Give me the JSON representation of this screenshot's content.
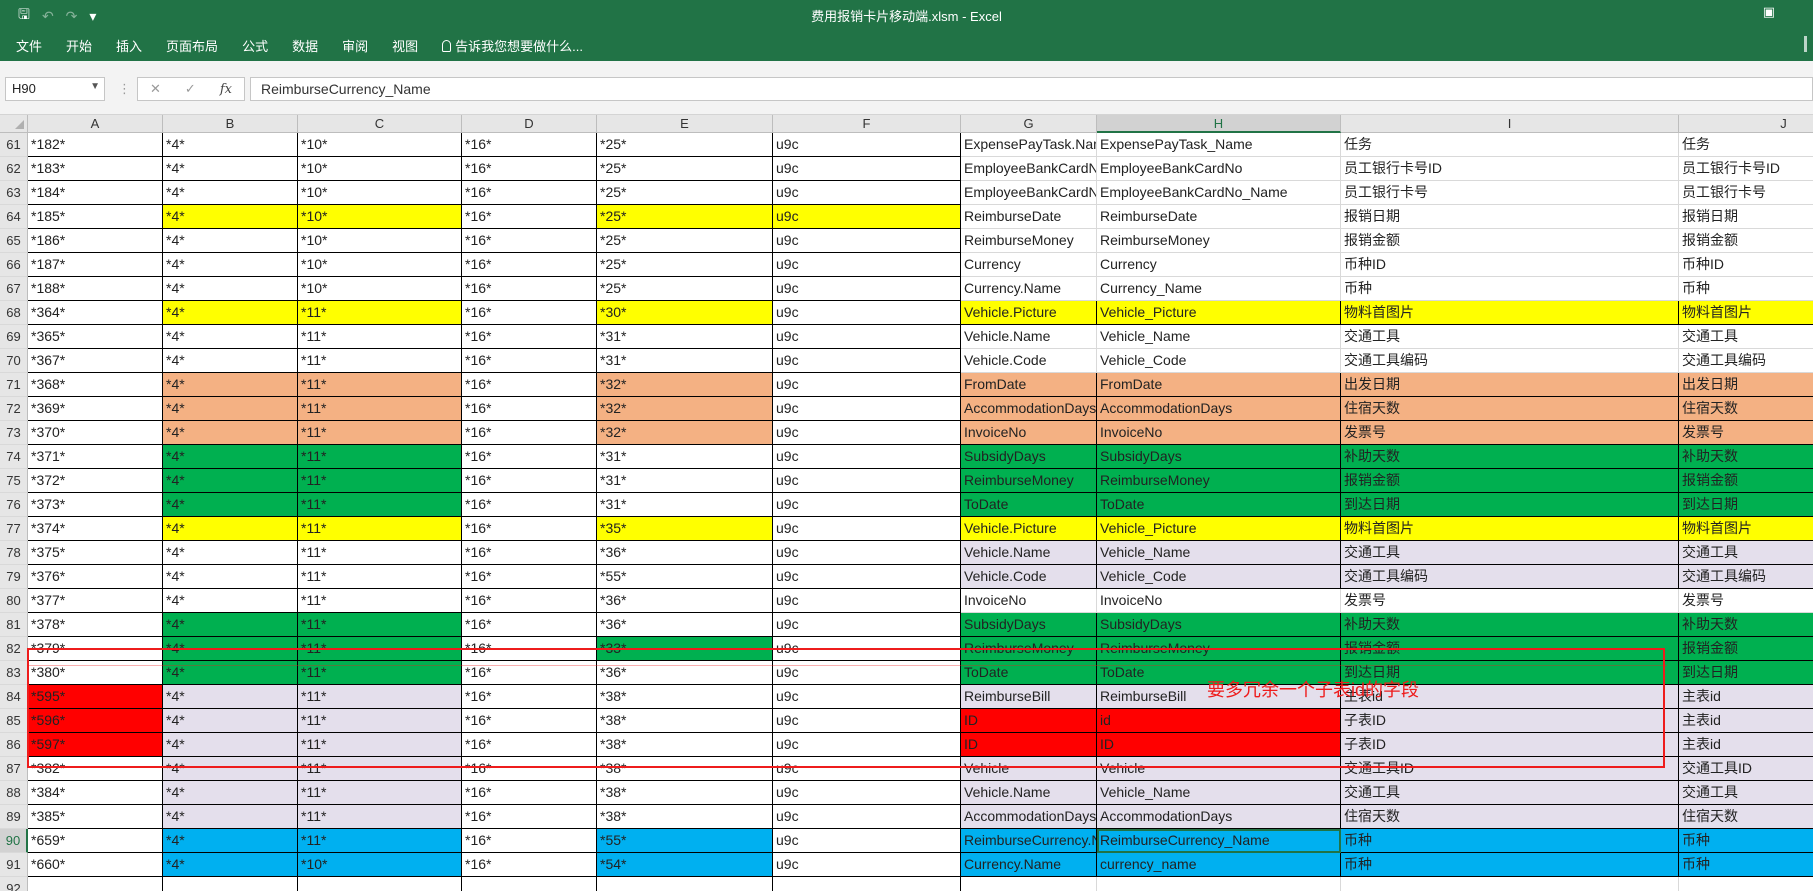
{
  "window": {
    "title": "费用报销卡片移动端.xlsm - Excel"
  },
  "quick_access": {
    "save_icon": "save-icon",
    "undo_icon": "undo-icon",
    "redo_icon": "redo-icon",
    "customize_icon": "customize-icon"
  },
  "ribbon": {
    "tabs": [
      "文件",
      "开始",
      "插入",
      "页面布局",
      "公式",
      "数据",
      "审阅",
      "视图"
    ],
    "tell_me": "告诉我您想要做什么..."
  },
  "formula_bar": {
    "name_box": "H90",
    "cancel": "✕",
    "enter": "✓",
    "fx": "fx",
    "value": "ReimburseCurrency_Name"
  },
  "columns": [
    "A",
    "B",
    "C",
    "D",
    "E",
    "F",
    "G",
    "H",
    "I",
    "J"
  ],
  "selected_column": "H",
  "selected_row": "90",
  "rows": [
    {
      "n": "61",
      "fill": {
        "A": "white",
        "B": "white",
        "C": "white",
        "D": "white",
        "E": "white",
        "F": "white",
        "G": "w",
        "H": "w",
        "I": "w",
        "J": "w"
      },
      "v": [
        "*182*",
        "*4*",
        "*10*",
        "*16*",
        "*25*",
        "u9c",
        "ExpensePayTask.Name",
        "ExpensePayTask_Name",
        "任务",
        "任务"
      ]
    },
    {
      "n": "62",
      "fill": {},
      "v": [
        "*183*",
        "*4*",
        "*10*",
        "*16*",
        "*25*",
        "u9c",
        "EmployeeBankCardNo",
        "EmployeeBankCardNo",
        "员工银行卡号ID",
        "员工银行卡号ID"
      ]
    },
    {
      "n": "63",
      "fill": {},
      "v": [
        "*184*",
        "*4*",
        "*10*",
        "*16*",
        "*25*",
        "u9c",
        "EmployeeBankCardNo",
        "EmployeeBankCardNo_Name",
        "员工银行卡号",
        "员工银行卡号"
      ]
    },
    {
      "n": "64",
      "fill": {
        "B": "yellow",
        "C": "yellow",
        "E": "yellow",
        "F": "yellow"
      },
      "v": [
        "*185*",
        "*4*",
        "*10*",
        "*16*",
        "*25*",
        "u9c",
        "ReimburseDate",
        "ReimburseDate",
        "报销日期",
        "报销日期"
      ]
    },
    {
      "n": "65",
      "fill": {},
      "v": [
        "*186*",
        "*4*",
        "*10*",
        "*16*",
        "*25*",
        "u9c",
        "ReimburseMoney",
        "ReimburseMoney",
        "报销金额",
        "报销金额"
      ]
    },
    {
      "n": "66",
      "fill": {},
      "v": [
        "*187*",
        "*4*",
        "*10*",
        "*16*",
        "*25*",
        "u9c",
        "Currency",
        "Currency",
        "币种ID",
        "币种ID"
      ]
    },
    {
      "n": "67",
      "fill": {},
      "v": [
        "*188*",
        "*4*",
        "*10*",
        "*16*",
        "*25*",
        "u9c",
        "Currency.Name",
        "Currency_Name",
        "币种",
        "币种"
      ]
    },
    {
      "n": "68",
      "fill": {
        "B": "yellow",
        "C": "yellow",
        "E": "yellow",
        "G": "yellow",
        "H": "yellow",
        "I": "yellow",
        "J": "yellow"
      },
      "v": [
        "*364*",
        "*4*",
        "*11*",
        "*16*",
        "*30*",
        "u9c",
        "Vehicle.Picture",
        "Vehicle_Picture",
        "物料首图片",
        "物料首图片"
      ]
    },
    {
      "n": "69",
      "fill": {},
      "v": [
        "*365*",
        "*4*",
        "*11*",
        "*16*",
        "*31*",
        "u9c",
        "Vehicle.Name",
        "Vehicle_Name",
        "交通工具",
        "交通工具"
      ]
    },
    {
      "n": "70",
      "fill": {},
      "v": [
        "*367*",
        "*4*",
        "*11*",
        "*16*",
        "*31*",
        "u9c",
        "Vehicle.Code",
        "Vehicle_Code",
        "交通工具编码",
        "交通工具编码"
      ]
    },
    {
      "n": "71",
      "fill": {
        "B": "peach",
        "C": "peach",
        "E": "peach",
        "G": "peach",
        "H": "peach",
        "I": "peach",
        "J": "peach"
      },
      "v": [
        "*368*",
        "*4*",
        "*11*",
        "*16*",
        "*32*",
        "u9c",
        "FromDate",
        "FromDate",
        "出发日期",
        "出发日期"
      ]
    },
    {
      "n": "72",
      "fill": {
        "B": "peach",
        "C": "peach",
        "E": "peach",
        "G": "peach",
        "H": "peach",
        "I": "peach",
        "J": "peach"
      },
      "v": [
        "*369*",
        "*4*",
        "*11*",
        "*16*",
        "*32*",
        "u9c",
        "AccommodationDays",
        "AccommodationDays",
        "住宿天数",
        "住宿天数"
      ]
    },
    {
      "n": "73",
      "fill": {
        "B": "peach",
        "C": "peach",
        "E": "peach",
        "G": "peach",
        "H": "peach",
        "I": "peach",
        "J": "peach"
      },
      "v": [
        "*370*",
        "*4*",
        "*11*",
        "*16*",
        "*32*",
        "u9c",
        "InvoiceNo",
        "InvoiceNo",
        "发票号",
        "发票号"
      ]
    },
    {
      "n": "74",
      "fill": {
        "B": "green",
        "C": "green",
        "G": "green",
        "H": "green",
        "I": "green",
        "J": "green"
      },
      "v": [
        "*371*",
        "*4*",
        "*11*",
        "*16*",
        "*31*",
        "u9c",
        "SubsidyDays",
        "SubsidyDays",
        "补助天数",
        "补助天数"
      ]
    },
    {
      "n": "75",
      "fill": {
        "B": "green",
        "C": "green",
        "G": "green",
        "H": "green",
        "I": "green",
        "J": "green"
      },
      "v": [
        "*372*",
        "*4*",
        "*11*",
        "*16*",
        "*31*",
        "u9c",
        "ReimburseMoney",
        "ReimburseMoney",
        "报销金额",
        "报销金额"
      ]
    },
    {
      "n": "76",
      "fill": {
        "B": "green",
        "C": "green",
        "G": "green",
        "H": "green",
        "I": "green",
        "J": "green"
      },
      "v": [
        "*373*",
        "*4*",
        "*11*",
        "*16*",
        "*31*",
        "u9c",
        "ToDate",
        "ToDate",
        "到达日期",
        "到达日期"
      ]
    },
    {
      "n": "77",
      "fill": {
        "B": "yellow",
        "C": "yellow",
        "E": "yellow",
        "G": "yellow",
        "H": "yellow",
        "I": "yellow",
        "J": "yellow"
      },
      "v": [
        "*374*",
        "*4*",
        "*11*",
        "*16*",
        "*35*",
        "u9c",
        "Vehicle.Picture",
        "Vehicle_Picture",
        "物料首图片",
        "物料首图片"
      ]
    },
    {
      "n": "78",
      "fill": {
        "G": "lav",
        "H": "lav",
        "I": "lav",
        "J": "lav"
      },
      "v": [
        "*375*",
        "*4*",
        "*11*",
        "*16*",
        "*36*",
        "u9c",
        "Vehicle.Name",
        "Vehicle_Name",
        "交通工具",
        "交通工具"
      ]
    },
    {
      "n": "79",
      "fill": {
        "G": "lav",
        "H": "lav",
        "I": "lav",
        "J": "lav"
      },
      "v": [
        "*376*",
        "*4*",
        "*11*",
        "*16*",
        "*55*",
        "u9c",
        "Vehicle.Code",
        "Vehicle_Code",
        "交通工具编码",
        "交通工具编码"
      ]
    },
    {
      "n": "80",
      "fill": {},
      "v": [
        "*377*",
        "*4*",
        "*11*",
        "*16*",
        "*36*",
        "u9c",
        "InvoiceNo",
        "InvoiceNo",
        "发票号",
        "发票号"
      ]
    },
    {
      "n": "81",
      "fill": {
        "B": "green",
        "C": "green",
        "G": "green",
        "H": "green",
        "I": "green",
        "J": "green"
      },
      "v": [
        "*378*",
        "*4*",
        "*11*",
        "*16*",
        "*36*",
        "u9c",
        "SubsidyDays",
        "SubsidyDays",
        "补助天数",
        "补助天数"
      ]
    },
    {
      "n": "82",
      "fill": {
        "B": "green",
        "C": "green",
        "E": "green",
        "G": "green",
        "H": "green",
        "I": "green",
        "J": "green"
      },
      "v": [
        "*379*",
        "*4*",
        "*11*",
        "*16*",
        "*33*",
        "u9c",
        "ReimburseMoney",
        "ReimburseMoney",
        "报销金额",
        "报销金额"
      ]
    },
    {
      "n": "83",
      "fill": {
        "B": "green",
        "C": "green",
        "G": "green",
        "H": "green",
        "I": "green",
        "J": "green"
      },
      "v": [
        "*380*",
        "*4*",
        "*11*",
        "*16*",
        "*36*",
        "u9c",
        "ToDate",
        "ToDate",
        "到达日期",
        "到达日期"
      ]
    },
    {
      "n": "84",
      "fill": {
        "A": "red",
        "B": "lav",
        "C": "lav",
        "G": "lav",
        "H": "lav",
        "I": "lav",
        "J": "lav"
      },
      "v": [
        "*595*",
        "*4*",
        "*11*",
        "*16*",
        "*38*",
        "u9c",
        "ReimburseBill",
        "ReimburseBill",
        "主表id",
        "主表id"
      ]
    },
    {
      "n": "85",
      "fill": {
        "A": "red",
        "B": "lav",
        "C": "lav",
        "G": "red",
        "H": "red",
        "I": "lav",
        "J": "lav"
      },
      "v": [
        "*596*",
        "*4*",
        "*11*",
        "*16*",
        "*38*",
        "u9c",
        "ID",
        "id",
        "子表ID",
        "主表id"
      ]
    },
    {
      "n": "86",
      "fill": {
        "A": "red",
        "B": "lav",
        "C": "lav",
        "G": "red",
        "H": "red",
        "I": "lav",
        "J": "lav"
      },
      "v": [
        "*597*",
        "*4*",
        "*11*",
        "*16*",
        "*38*",
        "u9c",
        "ID",
        "ID",
        "子表ID",
        "主表id"
      ]
    },
    {
      "n": "87",
      "fill": {
        "B": "lav",
        "C": "lav",
        "G": "lav",
        "H": "lav",
        "I": "lav",
        "J": "lav"
      },
      "v": [
        "*382*",
        "*4*",
        "*11*",
        "*16*",
        "*38*",
        "u9c",
        "Vehicle",
        "Vehicle",
        "交通工具ID",
        "交通工具ID"
      ]
    },
    {
      "n": "88",
      "fill": {
        "B": "lav",
        "C": "lav",
        "G": "lav",
        "H": "lav",
        "I": "lav",
        "J": "lav"
      },
      "v": [
        "*384*",
        "*4*",
        "*11*",
        "*16*",
        "*38*",
        "u9c",
        "Vehicle.Name",
        "Vehicle_Name",
        "交通工具",
        "交通工具"
      ]
    },
    {
      "n": "89",
      "fill": {
        "B": "lav",
        "C": "lav",
        "G": "lav",
        "H": "lav",
        "I": "lav",
        "J": "lav"
      },
      "v": [
        "*385*",
        "*4*",
        "*11*",
        "*16*",
        "*38*",
        "u9c",
        "AccommodationDays",
        "AccommodationDays",
        "住宿天数",
        "住宿天数"
      ]
    },
    {
      "n": "90",
      "fill": {
        "B": "blue",
        "C": "blue",
        "E": "blue",
        "G": "blue",
        "H": "blue",
        "I": "blue",
        "J": "blue"
      },
      "v": [
        "*659*",
        "*4*",
        "*11*",
        "*16*",
        "*55*",
        "u9c",
        "ReimburseCurrency.Name",
        "ReimburseCurrency_Name",
        "币种",
        "币种"
      ]
    },
    {
      "n": "91",
      "fill": {
        "B": "blue",
        "C": "blue",
        "E": "blue",
        "G": "blue",
        "H": "blue",
        "I": "blue",
        "J": "blue"
      },
      "v": [
        "*660*",
        "*4*",
        "*10*",
        "*16*",
        "*54*",
        "u9c",
        "Currency.Name",
        "currency_name",
        "币种",
        "币种"
      ]
    },
    {
      "n": "92",
      "fill": {},
      "v": [
        "",
        "",
        "",
        "",
        "",
        "",
        "",
        "",
        "",
        ""
      ]
    }
  ],
  "annotation": {
    "text": "要多冗余一个子表id的字段"
  },
  "colors": {
    "excel_green": "#217346",
    "yellow": "#ffff00",
    "peach": "#f4b183",
    "green": "#00b050",
    "lavender": "#e4dfec",
    "red": "#ff0000",
    "blue": "#00b0f0",
    "annotation_red": "#ee1c1c"
  }
}
